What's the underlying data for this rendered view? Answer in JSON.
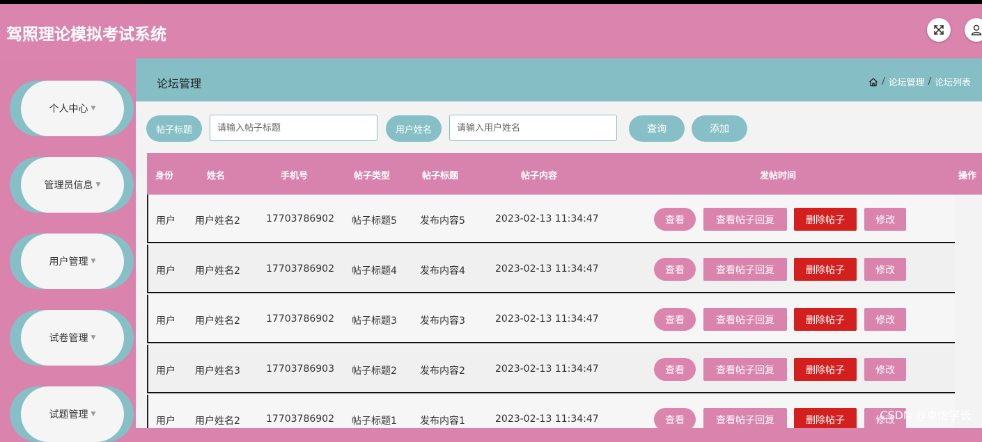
{
  "app": {
    "title": "驾照理论模拟考试系统"
  },
  "header": {
    "fullscreen_icon": "expand-icon",
    "user_icon": "user-icon"
  },
  "sidebar": {
    "items": [
      {
        "label": "个人中心"
      },
      {
        "label": "管理员信息"
      },
      {
        "label": "用户管理"
      },
      {
        "label": "试卷管理"
      },
      {
        "label": "试题管理"
      }
    ]
  },
  "page": {
    "title": "论坛管理",
    "breadcrumb": {
      "home_icon": "home-icon",
      "level1": "论坛管理",
      "level2": "论坛列表"
    }
  },
  "search": {
    "title_label": "帖子标题",
    "title_placeholder": "请输入帖子标题",
    "name_label": "用户姓名",
    "name_placeholder": "请输入用户姓名",
    "query_button": "查询",
    "add_button": "添加"
  },
  "table": {
    "headers": [
      "身份",
      "姓名",
      "手机号",
      "帖子类型",
      "帖子标题",
      "帖子内容",
      "发帖时间",
      "操作"
    ],
    "rows": [
      {
        "identity": "用户",
        "name": "用户姓名2",
        "phone": "17703786902",
        "title": "帖子标题5",
        "content": "发布内容5",
        "time": "2023-02-13 11:34:47"
      },
      {
        "identity": "用户",
        "name": "用户姓名2",
        "phone": "17703786902",
        "title": "帖子标题4",
        "content": "发布内容4",
        "time": "2023-02-13 11:34:47"
      },
      {
        "identity": "用户",
        "name": "用户姓名2",
        "phone": "17703786902",
        "title": "帖子标题3",
        "content": "发布内容3",
        "time": "2023-02-13 11:34:47"
      },
      {
        "identity": "用户",
        "name": "用户姓名3",
        "phone": "17703786903",
        "title": "帖子标题2",
        "content": "发布内容2",
        "time": "2023-02-13 11:34:47"
      },
      {
        "identity": "用户",
        "name": "用户姓名2",
        "phone": "17703786902",
        "title": "帖子标题1",
        "content": "发布内容1",
        "time": "2023-02-13 11:34:47"
      }
    ],
    "actions": {
      "view": "查看",
      "view_replies": "查看帖子回复",
      "delete": "删除帖子",
      "edit": "修改"
    }
  },
  "watermark": "CSDN @卓怡学长",
  "colors": {
    "pink": "#d983ad",
    "teal": "#86c0c6",
    "danger": "#d3201f"
  }
}
